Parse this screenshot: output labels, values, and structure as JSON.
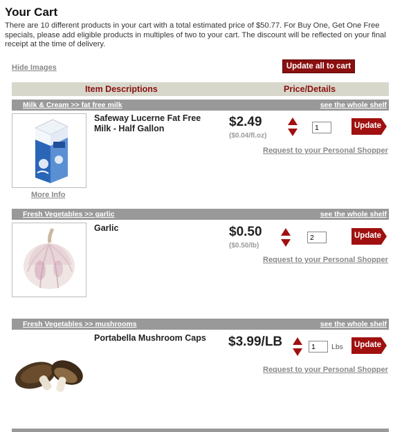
{
  "page": {
    "title": "Your Cart",
    "intro": "There are 10 different products in your cart with a total estimated price of $50.77. For Buy One, Get One Free specials, please add eligible products in multiples of two to your cart. The discount will be reflected on your final receipt at the time of delivery.",
    "hide_images": "Hide Images",
    "update_all": "Update all to cart",
    "col_items": "Item Descriptions",
    "col_price": "Price/Details"
  },
  "items": [
    {
      "category": "Milk & Cream >> fat free milk",
      "shelf_link": "see the whole shelf",
      "name": "Safeway Lucerne Fat Free Milk - Half Gallon",
      "price": "$2.49",
      "unit_price": "($0.04/fl.oz)",
      "qty": "1",
      "update": "Update",
      "shopper_link": "Request to your Personal Shopper",
      "more_info": "More Info",
      "image_icon": "milk-carton-image"
    },
    {
      "category": "Fresh Vegetables >> garlic",
      "shelf_link": "see the whole shelf",
      "name": "Garlic",
      "price": "$0.50",
      "unit_price": "($0.50/lb)",
      "qty": "2",
      "update": "Update",
      "shopper_link": "Request to your Personal Shopper",
      "image_icon": "garlic-image"
    },
    {
      "category": "Fresh Vegetables >> mushrooms",
      "shelf_link": "see the whole shelf",
      "name": "Portabella Mushroom Caps",
      "price": "$3.99/LB",
      "qty": "1",
      "qty_unit": "Lbs",
      "update": "Update",
      "shopper_link": "Request to your Personal Shopper",
      "image_icon": "mushroom-image"
    }
  ],
  "colors": {
    "accent": "#8b1010",
    "category_bar": "#999999",
    "header_bar": "#d8d7cb"
  }
}
